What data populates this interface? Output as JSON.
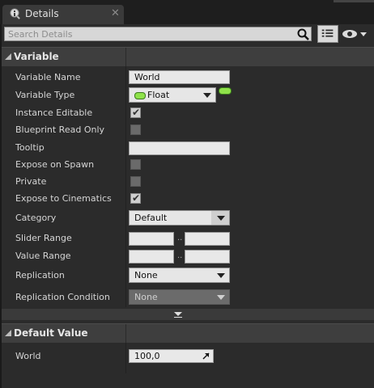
{
  "tab": {
    "label": "Details",
    "icon": "magnifier-details-icon",
    "close": "✕"
  },
  "search": {
    "placeholder": "Search Details",
    "value": ""
  },
  "toolbar": {
    "view_options_icon": "list-view-icon",
    "visibility_icon": "eye-dropdown-icon"
  },
  "variable_section": {
    "title": "Variable",
    "rows": [
      {
        "label": "Variable Name",
        "type": "text",
        "value": "World"
      },
      {
        "label": "Variable Type",
        "type": "type-combo",
        "value": "Float",
        "pin_color": "#8fe24a"
      },
      {
        "label": "Instance Editable",
        "type": "checkbox",
        "checked": true
      },
      {
        "label": "Blueprint Read Only",
        "type": "checkbox",
        "checked": false
      },
      {
        "label": "Tooltip",
        "type": "text",
        "value": ""
      },
      {
        "label": "Expose on Spawn",
        "type": "checkbox",
        "checked": false
      },
      {
        "label": "Private",
        "type": "checkbox",
        "checked": false
      },
      {
        "label": "Expose to Cinematics",
        "type": "checkbox",
        "checked": true
      },
      {
        "label": "Category",
        "type": "combo",
        "value": "Default"
      },
      {
        "label": "Slider Range",
        "type": "range",
        "min": "",
        "max": "",
        "separator": ".."
      },
      {
        "label": "Value Range",
        "type": "range",
        "min": "",
        "max": "",
        "separator": ".."
      },
      {
        "label": "Replication",
        "type": "combo",
        "value": "None"
      },
      {
        "label": "Replication Condition",
        "type": "combo-disabled",
        "value": "None"
      }
    ]
  },
  "default_section": {
    "title": "Default Value",
    "rows": [
      {
        "label": "World",
        "type": "number",
        "value": "100,0"
      }
    ]
  }
}
